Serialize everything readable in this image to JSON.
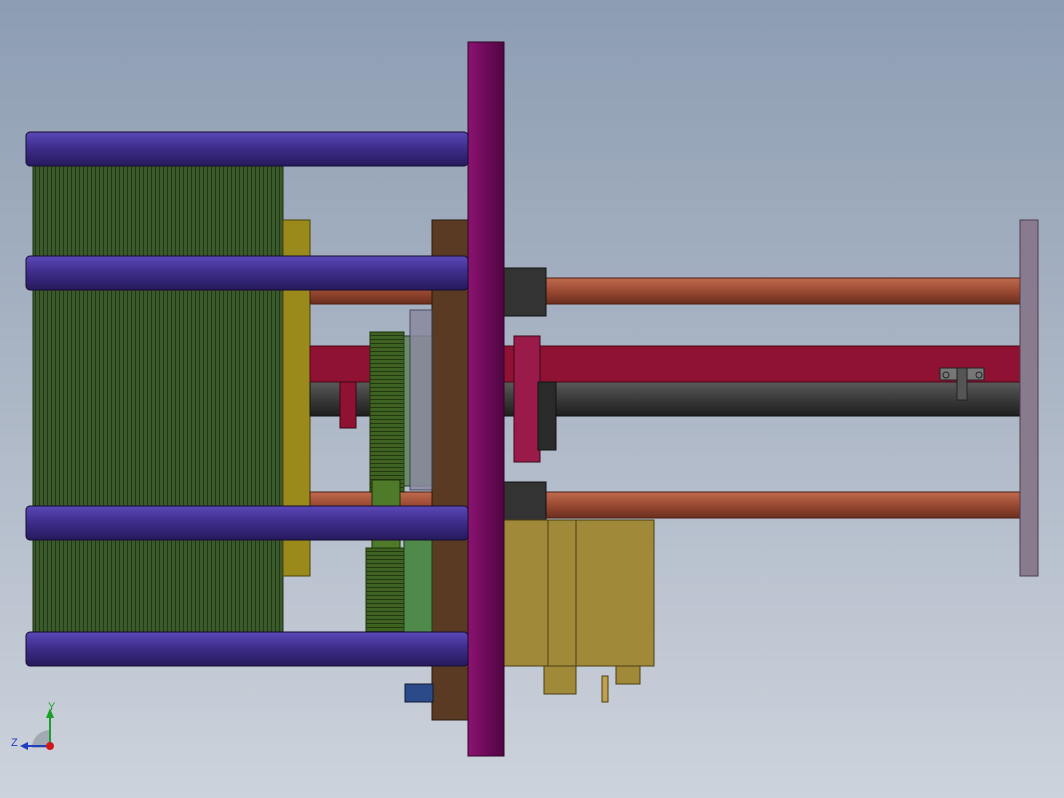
{
  "viewport": {
    "background_top": "#8d9db2",
    "background_bottom": "#cdd3dc"
  },
  "colors": {
    "frame_plate": "#6e0a5a",
    "tie_rod": "#3f2e8c",
    "fin_block": "#3b5a2a",
    "yellow_plate": "#9a8a1c",
    "copper_rod": "#9a4a32",
    "red_beam": "#8f1232",
    "dark_shaft": "#3a3a3a",
    "end_plate": "#8a7a8e",
    "motor_body": "#a08a3a",
    "gear_green": "#4f7a2a",
    "bracket_brown": "#5a3a22"
  },
  "triad": {
    "y_label": "Y",
    "z_label": "Z",
    "x_axis_color": "#d01818",
    "y_axis_color": "#1aa02a",
    "z_axis_color": "#2040c0"
  }
}
